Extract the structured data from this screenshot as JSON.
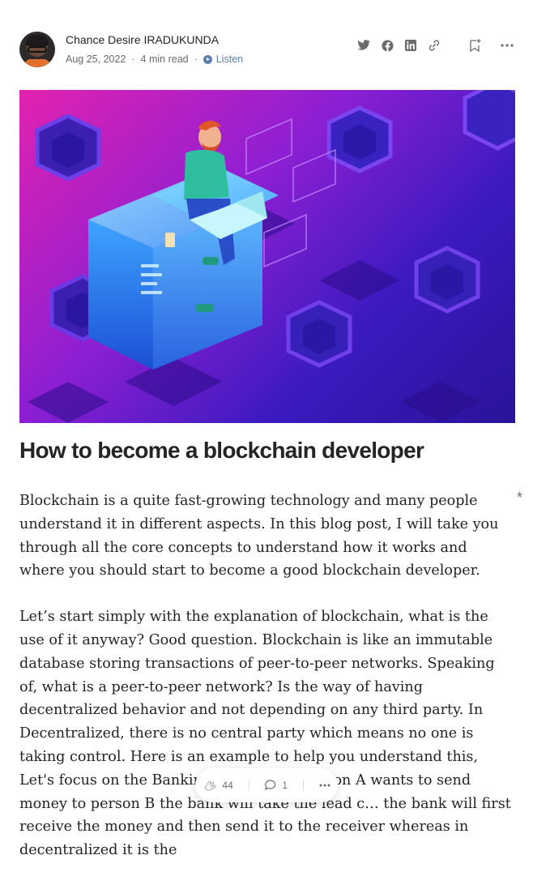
{
  "author": {
    "name": "Chance Desire IRADUKUNDA",
    "date": "Aug 25, 2022",
    "read_time": "4 min read",
    "listen_label": "Listen"
  },
  "share": {
    "icons": [
      "twitter-icon",
      "facebook-icon",
      "linkedin-icon",
      "link-icon",
      "bookmark-add-icon",
      "more-icon"
    ]
  },
  "hero": {
    "alt": "Isometric illustration of a developer with laptop sitting on a glowing block among hexagon blocks"
  },
  "article": {
    "title": "How to become a blockchain developer",
    "paragraphs": [
      "Blockchain is a quite fast-growing technology and many people understand it in different aspects. In this blog post, I will take you through all the core concepts to understand how it works and where you should start to become a good blockchain developer.",
      "Let’s start simply with the explanation of blockchain, what is the use of it anyway? Good question. Blockchain is like an immutable database storing transactions of peer-to-peer networks. Speaking of, what is a peer-to-peer network? Is the way of having decentralized behavior and not depending on any third party. In Decentralized, there is no central party which means no one is taking control. Here is an example to help you understand this, Let's focus on the Banking scenario. If person A wants to send money to person B the bank will take the lead c… the bank will first receive the money and then send it to the receiver whereas in decentralized it is the"
    ]
  },
  "floating_bar": {
    "claps": "44",
    "responses": "1"
  },
  "colors": {
    "listen": "#5d7eb1",
    "muted": "#6b6b6b",
    "text": "#242424"
  }
}
